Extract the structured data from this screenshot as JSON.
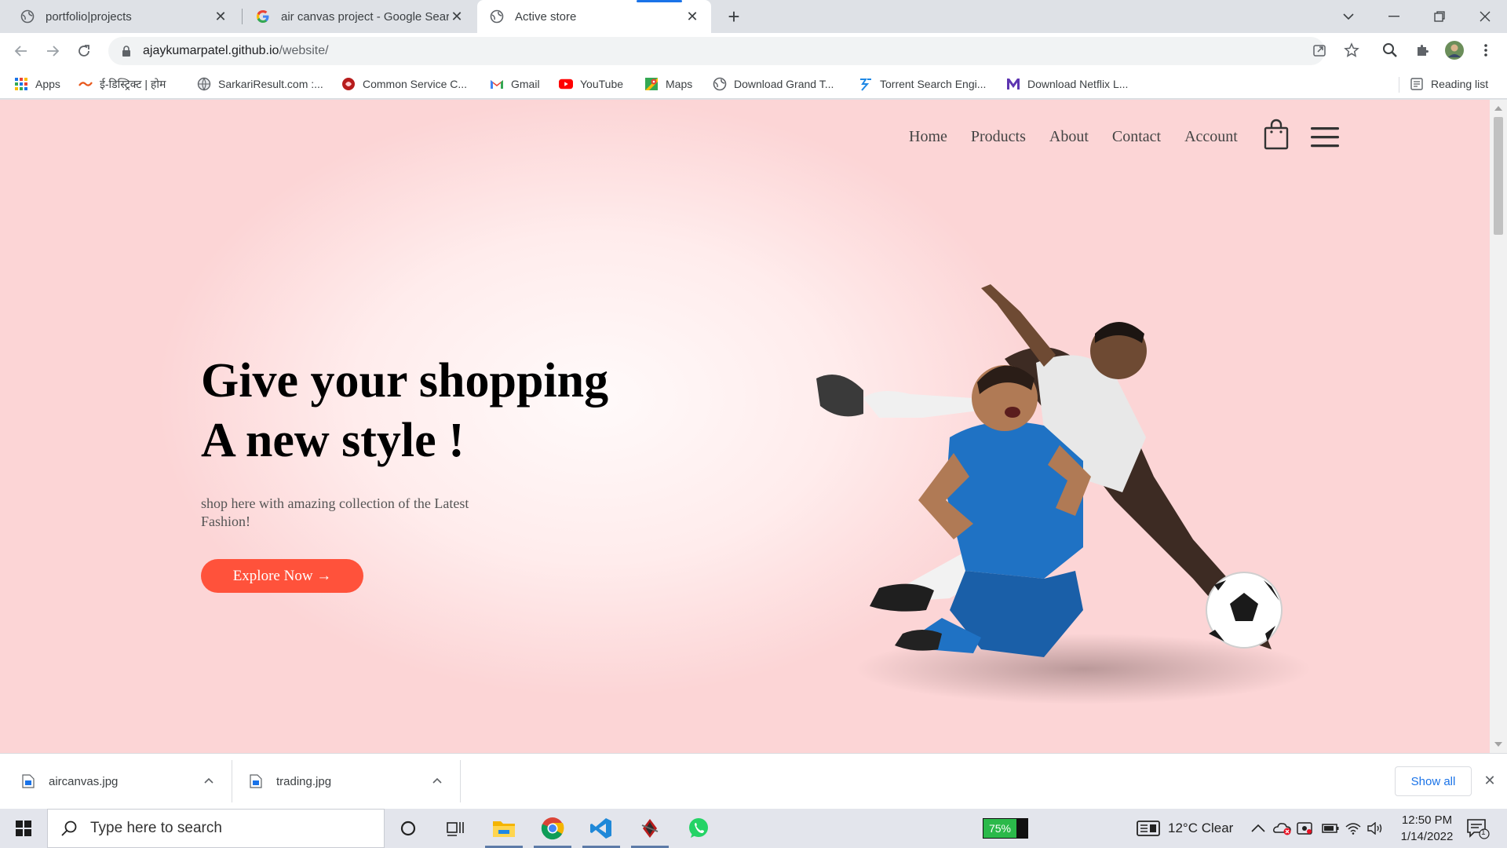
{
  "browser": {
    "tabs": [
      {
        "title": "portfolio|projects",
        "active": false
      },
      {
        "title": "air canvas project - Google Searc",
        "active": false
      },
      {
        "title": "Active store",
        "active": true
      }
    ],
    "address": {
      "domain": "ajaykumarpatel.github.io",
      "path": "/website/"
    },
    "bookmarks": [
      {
        "label": "Apps",
        "icon": "apps-grid-icon"
      },
      {
        "label": "ई-डिस्ट्रिक्ट | होम",
        "icon": "edistrict-icon"
      },
      {
        "label": "SarkariResult.com :...",
        "icon": "globe-icon"
      },
      {
        "label": "Common Service C...",
        "icon": "csc-icon"
      },
      {
        "label": "Gmail",
        "icon": "gmail-icon"
      },
      {
        "label": "YouTube",
        "icon": "youtube-icon"
      },
      {
        "label": "Maps",
        "icon": "maps-icon"
      },
      {
        "label": "Download Grand T...",
        "icon": "globe-icon"
      },
      {
        "label": "Torrent Search Engi...",
        "icon": "torrent-icon"
      },
      {
        "label": "Download Netflix L...",
        "icon": "netflix-m-icon"
      }
    ],
    "reading_list": "Reading list"
  },
  "site": {
    "nav": [
      "Home",
      "Products",
      "About",
      "Contact",
      "Account"
    ],
    "hero": {
      "title_line1": "Give your shopping",
      "title_line2": "A new style !",
      "subtitle": "shop here with amazing collection of the Latest Fashion!",
      "cta": "Explore Now →"
    },
    "accent": "#ff523b"
  },
  "downloads": {
    "items": [
      "aircanvas.jpg",
      "trading.jpg"
    ],
    "show_all": "Show all"
  },
  "taskbar": {
    "search_placeholder": "Type here to search",
    "battery_percent": "75%",
    "battery_level": 0.75,
    "weather": "12°C  Clear",
    "time": "12:50 PM",
    "date": "1/14/2022",
    "notification_count": "1"
  }
}
